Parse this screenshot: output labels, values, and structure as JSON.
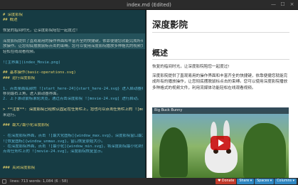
{
  "window": {
    "title": "index.md (Edited)",
    "controls": [
      "—",
      "☐",
      "×"
    ]
  },
  "editor": {
    "lines": [
      {
        "text": "# 深度影院",
        "cls": "c-head"
      },
      {
        "text": "## 概述",
        "cls": "c-head"
      },
      {
        "text": "",
        "cls": "c-text"
      },
      {
        "text": "恢复的指间时光，让深度影院陪您一起度过!",
        "cls": "c-text"
      },
      {
        "text": "",
        "cls": "c-text"
      },
      {
        "text": "深度影院提供了直观易用的操作界面和丰富齐全的快捷键，依靠便捷您就能完成所有的播放操作。",
        "cls": "c-text"
      },
      {
        "text": "放操作。让您彻底摆脱鼠标点击的束缚。您可以使用深度影院播放多种格式的视频文件，利用流媒体功能",
        "cls": "c-text"
      },
      {
        "text": "轻松在线观看视频。",
        "cls": "c-text"
      },
      {
        "text": "",
        "cls": "c-text"
      },
      {
        "text": "  ![主界面](index_Movie.png)",
        "cls": "c-link"
      },
      {
        "text": "",
        "cls": "c-text"
      },
      {
        "text": "## 基本操作(basic-operations.svg)",
        "cls": "c-head"
      },
      {
        "text": "### 运行深度影院",
        "cls": "c-head"
      },
      {
        "text": "",
        "cls": "c-text"
      },
      {
        "text": "1. 点击桌面底部的 ![start_here-24]{start_here-24.svg} 进入启动器界面。",
        "cls": "c-link"
      },
      {
        "text": "   移到最右上角，进入启动器界面。",
        "cls": "c-text"
      },
      {
        "text": "2. 上下滚动鼠标滚轮浏览，通过点击深度影院 ![movie-24.svg] 进行启动。",
        "cls": "c-link"
      },
      {
        "text": "",
        "cls": "c-text"
      },
      {
        "text": "> **注意**: 深度影院已经默认固定在任务栏上，您也可以点击任务栏上的 ![movie-24.svg]",
        "cls": "c-bold"
      },
      {
        "text": "   来运行。",
        "cls": "c-text"
      },
      {
        "text": "",
        "cls": "c-text"
      },
      {
        "text": "### 最大/最小化深度影院",
        "cls": "c-head"
      },
      {
        "text": "",
        "cls": "c-text"
      },
      {
        "text": "- 在深度影院界面，点击 ![最大化图标]{window_max.svg}，深度影院窗口最大化显示。",
        "cls": "c-link"
      },
      {
        "text": "  ![恢复图标]{window_unmax.svg}，窗口恢复原始大小。",
        "cls": "c-link"
      },
      {
        "text": "- 在深度影院界面，点击 ![最小化]{window_min.svg}，将深度影院最小化到任务栏。",
        "cls": "c-link"
      },
      {
        "text": "  点击任务栏上的 ![movie-24.svg]，深度影院恢复显示。",
        "cls": "c-link"
      },
      {
        "text": "",
        "cls": "c-text"
      },
      {
        "text": "",
        "cls": "c-text"
      },
      {
        "text": "### 关闭深度影院",
        "cls": "c-head"
      },
      {
        "text": "",
        "cls": "c-text"
      }
    ]
  },
  "preview": {
    "h1": "深度影院",
    "h2": "概述",
    "p1": "恢复的指间时光，让深度影院陪您一起度过!",
    "p2": "深度影院提供了直观易用的操作界面和丰富齐全的快捷键，依靠便捷您就能完成所有的播放操作，让您彻底摆脱鼠标点击的束缚。您可以使用深度影院播放多种格式的视频文件，利用流媒体功能轻松在线观看视频。",
    "video_title": "Big Buck Bunny"
  },
  "status": {
    "info": "lines: 713   words: 1,084   (6 : 58)",
    "donate": "♥ Donate",
    "share": "Share ▾",
    "spaces": "Spaces ▾",
    "columns": "Columns ▾"
  },
  "colors": {
    "editor_bg": "#163b43",
    "donate": "#c0392b",
    "accent": "#2e86c1"
  }
}
